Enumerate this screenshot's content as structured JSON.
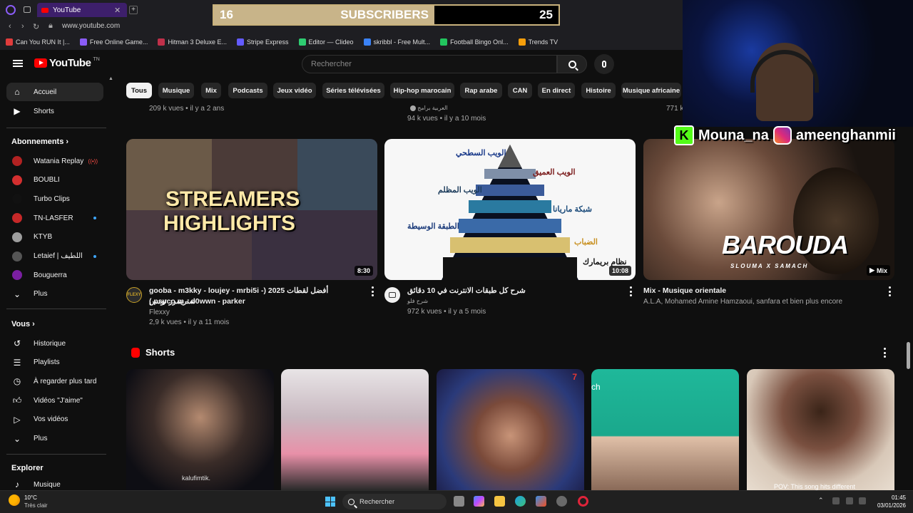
{
  "browser": {
    "tab_title": "YouTube",
    "url": "www.youtube.com",
    "bookmarks": [
      {
        "label": "Can You RUN It |...",
        "color": "#e03c3c"
      },
      {
        "label": "Free Online Game...",
        "color": "#8a5cf6"
      },
      {
        "label": "Hitman 3 Deluxe E...",
        "color": "#c0304a"
      },
      {
        "label": "Stripe Express",
        "color": "#635bff"
      },
      {
        "label": "Editor — Clideo",
        "color": "#2ecc71"
      },
      {
        "label": "skribbl - Free Mult...",
        "color": "#3b82f6"
      },
      {
        "label": "Football Bingo Onl...",
        "color": "#22c55e"
      },
      {
        "label": "Trends TV",
        "color": "#f59e0b"
      }
    ]
  },
  "overlay": {
    "sub_count": "16",
    "sub_label": "SUBSCRIBERS",
    "sub_goal": "25",
    "sub_progress": 0.64,
    "kick_handle": "Mouna_na",
    "instagram_handle": "ameenghanmii"
  },
  "header": {
    "logo_text": "YouTube",
    "logo_region": "TN",
    "search_placeholder": "Rechercher"
  },
  "sidebar": {
    "main": [
      {
        "label": "Accueil",
        "icon": "home-icon",
        "active": true
      },
      {
        "label": "Shorts",
        "icon": "shorts-icon"
      }
    ],
    "subscriptions_title": "Abonnements",
    "subscriptions": [
      {
        "label": "Watania Replay",
        "color": "#b22222",
        "badge": "live"
      },
      {
        "label": "BOUBLI",
        "color": "#d32f2f"
      },
      {
        "label": "Turbo Clips",
        "color": "#111111"
      },
      {
        "label": "TN-LASFER",
        "color": "#c62828",
        "badge": "dot"
      },
      {
        "label": "KTYB",
        "color": "#9e9e9e"
      },
      {
        "label": "Letaief | اللطيف",
        "color": "#555555",
        "badge": "dot"
      },
      {
        "label": "Bouguerra",
        "color": "#7b1fa2"
      },
      {
        "label": "Plus",
        "icon": "chevron-down-icon"
      }
    ],
    "you_title": "Vous",
    "you": [
      {
        "label": "Historique",
        "icon": "history-icon"
      },
      {
        "label": "Playlists",
        "icon": "playlists-icon"
      },
      {
        "label": "À regarder plus tard",
        "icon": "clock-icon"
      },
      {
        "label": "Vidéos \"J'aime\"",
        "icon": "thumbs-up-icon"
      },
      {
        "label": "Vos vidéos",
        "icon": "video-icon"
      },
      {
        "label": "Plus",
        "icon": "chevron-down-icon"
      }
    ],
    "explore_title": "Explorer",
    "explore": [
      {
        "label": "Musique",
        "icon": "music-icon"
      }
    ]
  },
  "chips": [
    "Tous",
    "Musique",
    "Mix",
    "Podcasts",
    "Jeux vidéo",
    "Séries télévisées",
    "Hip-hop marocain",
    "Rap arabe",
    "CAN",
    "En direct",
    "Histoire",
    "Musique africaine"
  ],
  "row_above": {
    "v1_meta": "209 k vues • il y a 2 ans",
    "v2_channel": "العربية برامج",
    "v2_meta": "94 k vues • il y a 10 mois",
    "v3_meta": "771 k"
  },
  "videos": [
    {
      "title_line1": "gooba - m3kky - loujey - mrbi5i -) 2025 أفضل لقطات ستريمرز تونس",
      "title_line2": "( psyco m - d0wwn - parker",
      "channel": "Flexxy",
      "meta": "2,9 k vues • il y a 11 mois",
      "duration": "8:30",
      "thumb_text_1": "STREAMERS",
      "thumb_text_2": "HIGHLIGHTS"
    },
    {
      "title_line1": "شرح كل طبقات الانترنت في 10 دقائق",
      "channel": "شرح فلو",
      "meta": "972 k vues • il y a 5 mois",
      "duration": "10:08",
      "layers": [
        "الويب السطحي",
        "الويب العميق",
        "الويب المظلم",
        "شبكة ماريانا",
        "الطبقة الوسيطة",
        "الضباب",
        "نظام بريمارك"
      ]
    },
    {
      "title_line1": "Mix - Musique orientale",
      "channel": "A.L.A, Mohamed Amine Hamzaoui, sanfara et bien plus encore",
      "badge": "Mix",
      "thumb_text_1": "BAROUDA",
      "thumb_text_2": "SLOUMA X SAMACH"
    }
  ],
  "shorts": {
    "title": "Shorts",
    "captions": [
      "kalufimtik.",
      "",
      "",
      "ch",
      "POV: This song hits different"
    ]
  },
  "taskbar": {
    "temp": "10°C",
    "weather": "Très clair",
    "search": "Rechercher",
    "time": "01:45",
    "date": "03/01/2026"
  }
}
